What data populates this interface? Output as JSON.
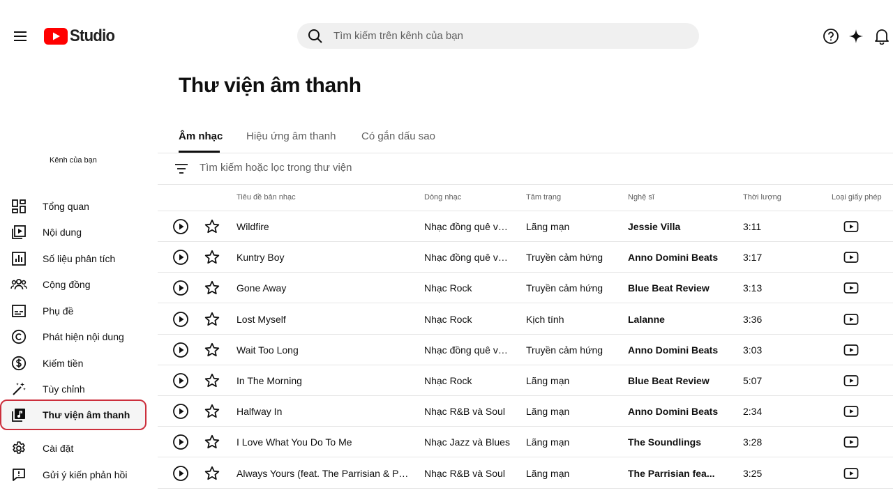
{
  "header": {
    "logo_text": "Studio",
    "search_placeholder": "Tìm kiếm trên kênh của bạn"
  },
  "sidebar": {
    "channel_label": "Kênh của bạn",
    "items": [
      {
        "label": "Tổng quan",
        "icon": "dashboard-icon"
      },
      {
        "label": "Nội dung",
        "icon": "content-icon"
      },
      {
        "label": "Số liệu phân tích",
        "icon": "analytics-icon"
      },
      {
        "label": "Cộng đồng",
        "icon": "community-icon"
      },
      {
        "label": "Phụ đề",
        "icon": "subtitles-icon"
      },
      {
        "label": "Phát hiện nội dung",
        "icon": "copyright-icon"
      },
      {
        "label": "Kiếm tiền",
        "icon": "dollar-icon"
      },
      {
        "label": "Tùy chỉnh",
        "icon": "magic-wand-icon"
      },
      {
        "label": "Thư viện âm thanh",
        "icon": "audio-library-icon",
        "active": true
      },
      {
        "label": "Cài đặt",
        "icon": "gear-icon"
      },
      {
        "label": "Gửi ý kiến phản hồi",
        "icon": "feedback-icon"
      }
    ]
  },
  "main": {
    "title": "Thư viện âm thanh",
    "tabs": [
      {
        "label": "Âm nhạc",
        "active": true
      },
      {
        "label": "Hiệu ứng âm thanh"
      },
      {
        "label": "Có gắn dấu sao"
      }
    ],
    "filter_placeholder": "Tìm kiếm hoặc lọc trong thư viện"
  },
  "table": {
    "columns": {
      "title": "Tiêu đề bản nhạc",
      "genre": "Dòng nhạc",
      "mood": "Tâm trạng",
      "artist": "Nghệ sĩ",
      "duration": "Thời lượng",
      "license": "Loại giấy phép"
    },
    "rows": [
      {
        "title": "Wildfire",
        "genre": "Nhạc đồng quê và...",
        "mood": "Lãng mạn",
        "artist": "Jessie Villa",
        "duration": "3:11"
      },
      {
        "title": "Kuntry Boy",
        "genre": "Nhạc đồng quê và...",
        "mood": "Truyền cảm hứng",
        "artist": "Anno Domini Beats",
        "duration": "3:17"
      },
      {
        "title": "Gone Away",
        "genre": "Nhạc Rock",
        "mood": "Truyền cảm hứng",
        "artist": "Blue Beat Review",
        "duration": "3:13"
      },
      {
        "title": "Lost Myself",
        "genre": "Nhạc Rock",
        "mood": "Kịch tính",
        "artist": "Lalanne",
        "duration": "3:36"
      },
      {
        "title": "Wait Too Long",
        "genre": "Nhạc đồng quê và...",
        "mood": "Truyền cảm hứng",
        "artist": "Anno Domini Beats",
        "duration": "3:03"
      },
      {
        "title": "In The Morning",
        "genre": "Nhạc Rock",
        "mood": "Lãng mạn",
        "artist": "Blue Beat Review",
        "duration": "5:07"
      },
      {
        "title": "Halfway In",
        "genre": "Nhạc R&B và Soul",
        "mood": "Lãng mạn",
        "artist": "Anno Domini Beats",
        "duration": "2:34"
      },
      {
        "title": "I Love What You Do To Me",
        "genre": "Nhạc Jazz và Blues",
        "mood": "Lãng mạn",
        "artist": "The Soundlings",
        "duration": "3:28"
      },
      {
        "title": "Always Yours (feat. The Parrisian & Parri...",
        "genre": "Nhạc R&B và Soul",
        "mood": "Lãng mạn",
        "artist": "The Parrisian fea...",
        "duration": "3:25"
      }
    ]
  }
}
